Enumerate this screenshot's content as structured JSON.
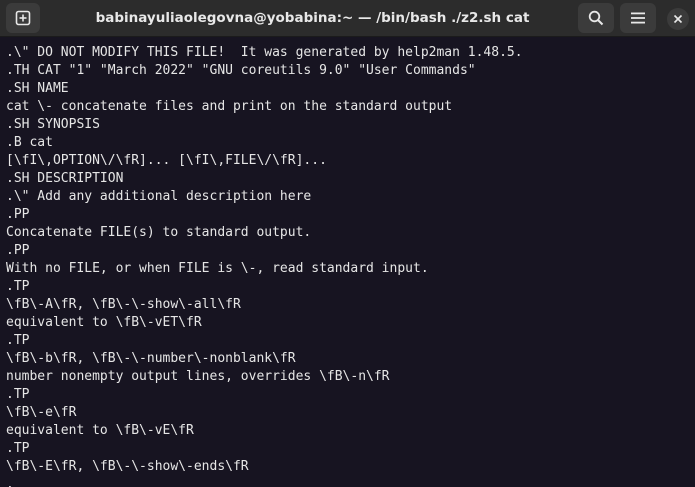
{
  "titlebar": {
    "title": "babinayuliaolegovna@yobabina:~ — /bin/bash ./z2.sh cat",
    "new_tab_icon": "new-tab-plus-icon",
    "search_icon": "magnifier-search-icon",
    "menu_icon": "hamburger-menu-icon",
    "close_icon": "close-x-icon"
  },
  "terminal": {
    "lines": [
      ".\\\" DO NOT MODIFY THIS FILE!  It was generated by help2man 1.48.5.",
      ".TH CAT \"1\" \"March 2022\" \"GNU coreutils 9.0\" \"User Commands\"",
      ".SH NAME",
      "cat \\- concatenate files and print on the standard output",
      ".SH SYNOPSIS",
      ".B cat",
      "[\\fI\\,OPTION\\/\\fR]... [\\fI\\,FILE\\/\\fR]...",
      ".SH DESCRIPTION",
      ".\\\" Add any additional description here",
      ".PP",
      "Concatenate FILE(s) to standard output.",
      ".PP",
      "With no FILE, or when FILE is \\-, read standard input.",
      ".TP",
      "\\fB\\-A\\fR, \\fB\\-\\-show\\-all\\fR",
      "equivalent to \\fB\\-vET\\fR",
      ".TP",
      "\\fB\\-b\\fR, \\fB\\-\\-number\\-nonblank\\fR",
      "number nonempty output lines, overrides \\fB\\-n\\fR",
      ".TP",
      "\\fB\\-e\\fR",
      "equivalent to \\fB\\-vE\\fR",
      ".TP",
      "\\fB\\-E\\fR, \\fB\\-\\-show\\-ends\\fR",
      "."
    ]
  },
  "colors": {
    "background": "#171421",
    "titlebar": "#2c2c2c",
    "text": "#e6e6e6"
  }
}
